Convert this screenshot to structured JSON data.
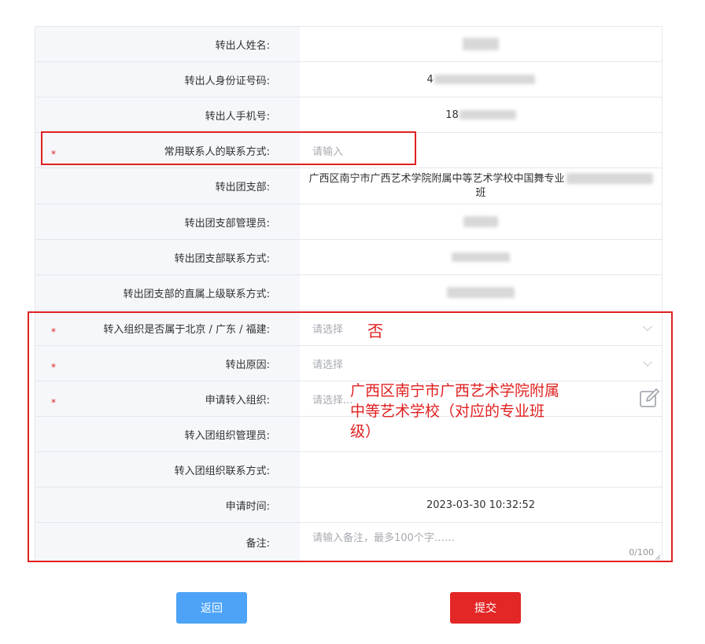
{
  "form": {
    "rows": [
      {
        "label": "转出人姓名:",
        "required": false
      },
      {
        "label": "转出人身份证号码:",
        "required": false,
        "value_prefix": "4"
      },
      {
        "label": "转出人手机号:",
        "required": false,
        "value_prefix": "18"
      },
      {
        "label": "常用联系人的联系方式:",
        "required": true,
        "placeholder": "请输入"
      },
      {
        "label": "转出团支部:",
        "required": false,
        "value_line1": "广西区南宁市广西艺术学院附属中等艺术学校中国舞专业",
        "value_line2": "班"
      },
      {
        "label": "转出团支部管理员:",
        "required": false
      },
      {
        "label": "转出团支部联系方式:",
        "required": false
      },
      {
        "label": "转出团支部的直属上级联系方式:",
        "required": false
      },
      {
        "label": "转入组织是否属于北京 / 广东 / 福建:",
        "required": true,
        "placeholder": "请选择"
      },
      {
        "label": "转出原因:",
        "required": true,
        "placeholder": "请选择"
      },
      {
        "label": "申请转入组织:",
        "required": true,
        "placeholder": "请选择..."
      },
      {
        "label": "转入团组织管理员:",
        "required": false
      },
      {
        "label": "转入团组织联系方式:",
        "required": false
      },
      {
        "label": "申请时间:",
        "required": false,
        "value": "2023-03-30 10:32:52"
      },
      {
        "label": "备注:",
        "required": false,
        "placeholder": "请输入备注，最多100个字……",
        "counter": "0/100"
      }
    ],
    "required_mark": "*"
  },
  "annotations": {
    "answer_no": "否",
    "target_org_line1": "广西区南宁市广西艺术学院附属",
    "target_org_line2": "中等艺术学校（对应的专业班",
    "target_org_line3": "级）"
  },
  "buttons": {
    "back": "返回",
    "submit": "提交"
  },
  "colors": {
    "annotation_red": "#e02020",
    "back_button": "#4da3f7",
    "submit_button": "#e32626",
    "label_bg": "#f5f7fa"
  },
  "icons": {
    "select_arrow": "chevron-down-icon",
    "edit": "edit-icon"
  }
}
